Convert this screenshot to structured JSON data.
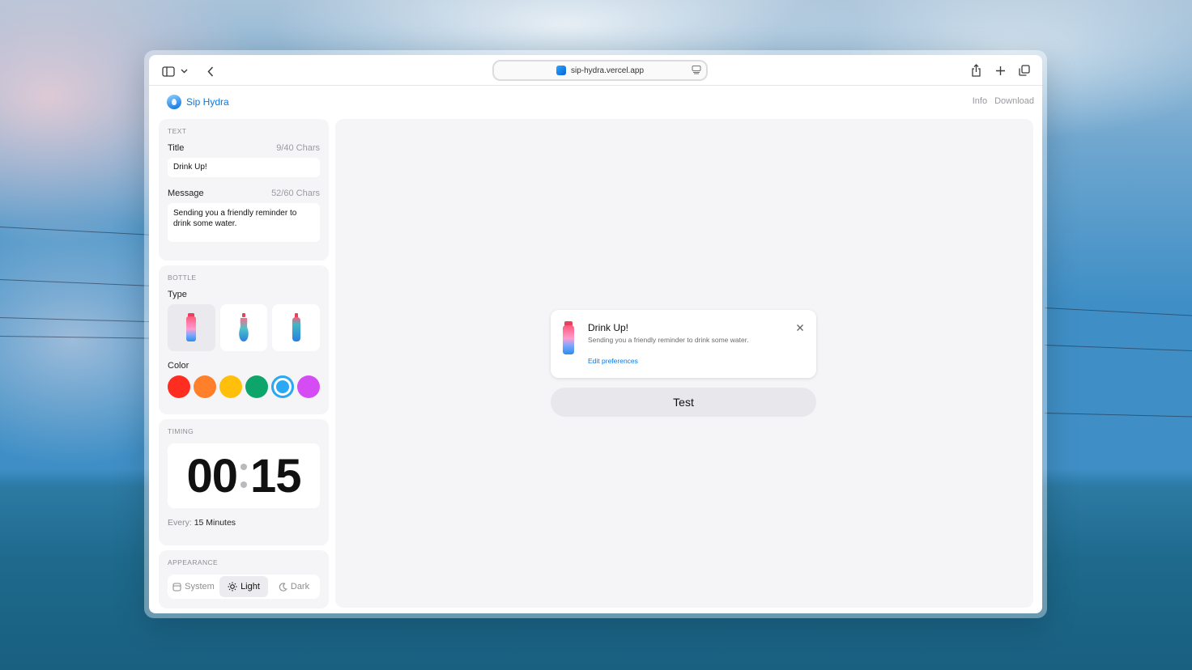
{
  "browser": {
    "url": "sip-hydra.vercel.app",
    "toolbar_icons": [
      "sidebar-icon",
      "chevron-down-icon",
      "back-icon",
      "share-icon",
      "plus-icon",
      "tabs-icon",
      "reader-icon"
    ]
  },
  "app": {
    "name": "Sip Hydra",
    "nav": {
      "info": "Info",
      "download": "Download"
    }
  },
  "text_section": {
    "label": "TEXT",
    "title_label": "Title",
    "title_count": "9/40 Chars",
    "title_value": "Drink Up!",
    "message_label": "Message",
    "message_count": "52/60 Chars",
    "message_value": "Sending you a friendly reminder to drink some water."
  },
  "bottle_section": {
    "label": "BOTTLE",
    "type_label": "Type",
    "types": [
      "bottle-straight",
      "bottle-curvy",
      "bottle-sport"
    ],
    "selected_type": 0,
    "color_label": "Color",
    "colors": [
      "#ff2d1f",
      "#ff7f2a",
      "#ffbf0a",
      "#0ea56b",
      "#2aa8f3",
      "#d54cf5"
    ],
    "selected_color": 4
  },
  "timing_section": {
    "label": "TIMING",
    "minutes": "00",
    "seconds": "15",
    "every_label": "Every:",
    "every_value": "15 Minutes"
  },
  "appearance_section": {
    "label": "APPEARANCE",
    "options": [
      "System",
      "Light",
      "Dark"
    ],
    "selected": "Light"
  },
  "preview": {
    "notification": {
      "title": "Drink Up!",
      "message": "Sending you a friendly reminder to drink some water.",
      "link": "Edit preferences"
    },
    "test_button": "Test"
  }
}
